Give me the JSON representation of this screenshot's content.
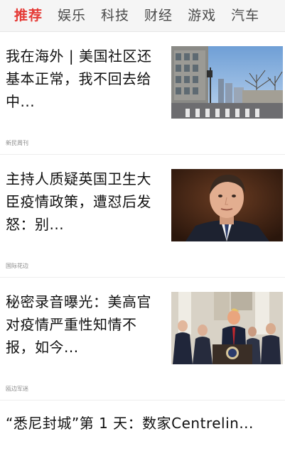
{
  "tabs": [
    {
      "label": "推荐",
      "active": true
    },
    {
      "label": "娱乐",
      "active": false
    },
    {
      "label": "科技",
      "active": false
    },
    {
      "label": "财经",
      "active": false
    },
    {
      "label": "游戏",
      "active": false
    },
    {
      "label": "汽车",
      "active": false
    }
  ],
  "articles": [
    {
      "title": "我在海外 | 美国社区还基本正常，我不回去给中...",
      "source": "新民周刊",
      "thumbnail": "city-street-photo"
    },
    {
      "title": "主持人质疑英国卫生大臣疫情政策，遭怼后发怒：别...",
      "source": "国际花边",
      "thumbnail": "tv-host-portrait-photo"
    },
    {
      "title": "秘密录音曝光：美高官对疫情严重性知情不报，如今...",
      "source": "瓯边军迷",
      "thumbnail": "press-conference-photo"
    },
    {
      "title": "“悉尼封城”第 1 天：数家Centrelin...",
      "source": "",
      "thumbnail": ""
    }
  ],
  "colors": {
    "active_tab": "#e53935",
    "tab": "#4a4a4a",
    "title": "#111111",
    "source": "#8a8a8a"
  }
}
